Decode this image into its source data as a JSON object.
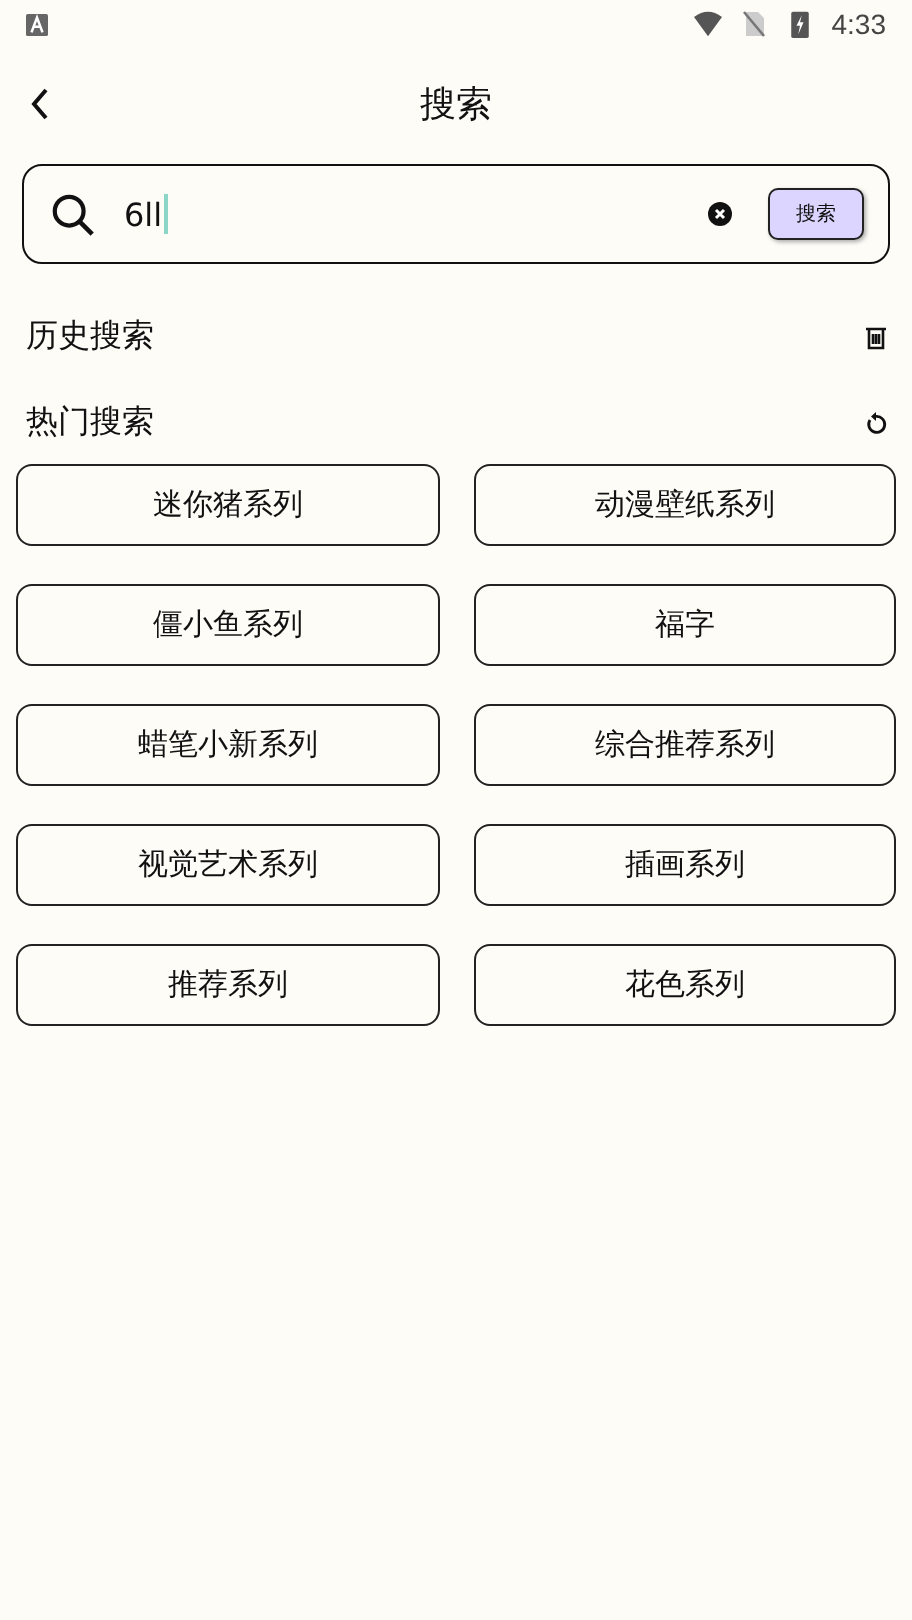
{
  "status_bar": {
    "time": "4:33"
  },
  "header": {
    "title": "搜索"
  },
  "search": {
    "value": "6ll",
    "button": "搜索"
  },
  "history": {
    "title": "历史搜索"
  },
  "hot": {
    "title": "热门搜索",
    "items": [
      "迷你猪系列",
      "动漫壁纸系列",
      "僵小鱼系列",
      "福字",
      "蜡笔小新系列",
      "综合推荐系列",
      "视觉艺术系列",
      "插画系列",
      "推荐系列",
      "花色系列"
    ]
  }
}
